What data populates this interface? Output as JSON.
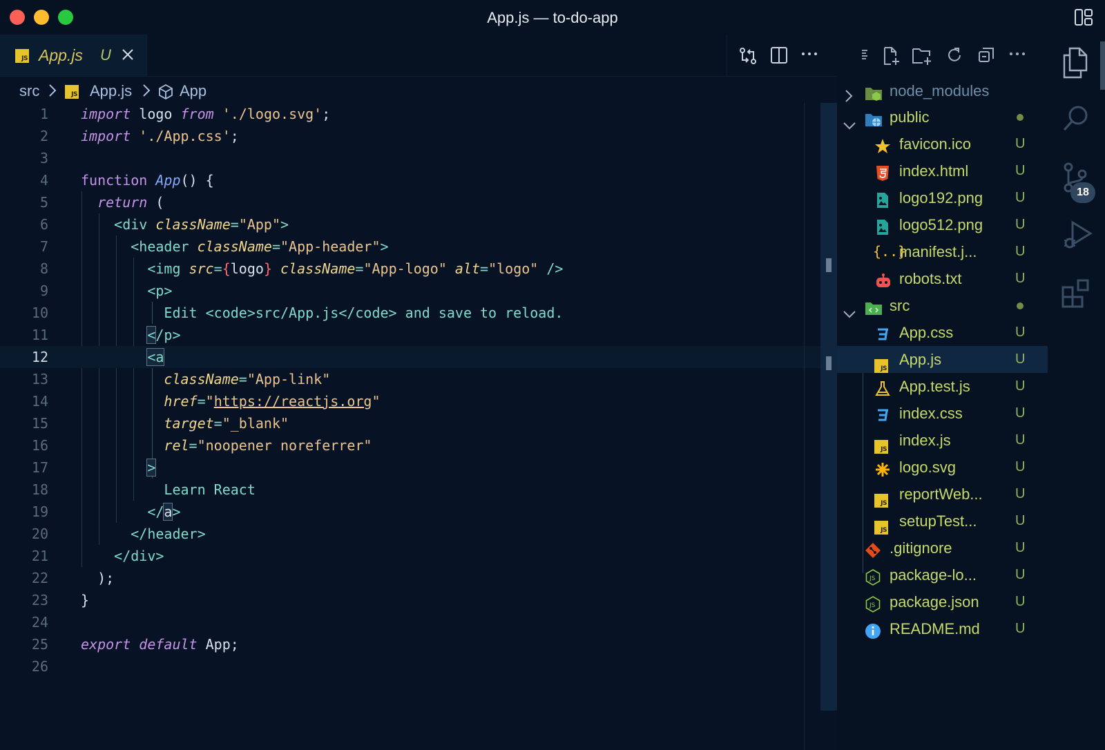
{
  "window": {
    "title": "App.js — to-do-app"
  },
  "tab": {
    "label": "App.js",
    "status": "U",
    "icon": "js-file-icon"
  },
  "breadcrumb": {
    "folder": "src",
    "file": "App.js",
    "symbol": "App"
  },
  "editor": {
    "current_line": 12,
    "lines": [
      {
        "n": "1"
      },
      {
        "n": "2"
      },
      {
        "n": "3"
      },
      {
        "n": "4"
      },
      {
        "n": "5"
      },
      {
        "n": "6"
      },
      {
        "n": "7"
      },
      {
        "n": "8"
      },
      {
        "n": "9"
      },
      {
        "n": "10"
      },
      {
        "n": "11"
      },
      {
        "n": "12"
      },
      {
        "n": "13"
      },
      {
        "n": "14"
      },
      {
        "n": "15"
      },
      {
        "n": "16"
      },
      {
        "n": "17"
      },
      {
        "n": "18"
      },
      {
        "n": "19"
      },
      {
        "n": "20"
      },
      {
        "n": "21"
      },
      {
        "n": "22"
      },
      {
        "n": "23"
      },
      {
        "n": "24"
      },
      {
        "n": "25"
      },
      {
        "n": "26"
      }
    ],
    "code": {
      "l1": [
        "import",
        "logo",
        "from",
        "'./logo.svg'",
        ";"
      ],
      "l2": [
        "import",
        "'./App.css'",
        ";"
      ],
      "l4": [
        "function",
        "App",
        "() {"
      ],
      "l5": [
        "return",
        "("
      ],
      "l6": [
        "<div",
        "className",
        "=",
        "\"App\"",
        ">"
      ],
      "l7": [
        "<header",
        "className",
        "=",
        "\"App-header\"",
        ">"
      ],
      "l8": [
        "<img",
        "src",
        "=",
        "{",
        "logo",
        "}",
        "className",
        "=",
        "\"App-logo\"",
        "alt",
        "=",
        "\"logo\"",
        "/>"
      ],
      "l9": [
        "<p>"
      ],
      "l10": [
        "Edit ",
        "<code>",
        "src/App.js",
        "</code>",
        " and save to reload."
      ],
      "l11": [
        "<",
        "/p>"
      ],
      "l12": [
        "<a"
      ],
      "l13": [
        "className",
        "=",
        "\"App-link\""
      ],
      "l14": [
        "href",
        "=",
        "\"",
        "https://reactjs.org",
        "\""
      ],
      "l15": [
        "target",
        "=",
        "\"_blank\""
      ],
      "l16": [
        "rel",
        "=",
        "\"noopener noreferrer\""
      ],
      "l17": [
        ">"
      ],
      "l18": [
        "Learn React"
      ],
      "l19": [
        "</",
        "a",
        ">"
      ],
      "l20": [
        "</header>"
      ],
      "l21": [
        "</div>"
      ],
      "l22": [
        ");"
      ],
      "l23": [
        "}"
      ],
      "l25": [
        "export",
        "default",
        "App;"
      ]
    }
  },
  "explorer": {
    "items": [
      {
        "name": "node_modules",
        "type": "folder",
        "expanded": false,
        "status": "",
        "icon": "node-folder-icon",
        "color": "#6f8fa8"
      },
      {
        "name": "public",
        "type": "folder",
        "expanded": true,
        "status": "dot",
        "icon": "public-folder-icon",
        "color": "#c6d96a"
      },
      {
        "name": "favicon.ico",
        "type": "file",
        "status": "U",
        "icon": "star-icon",
        "color": "#c6d96a"
      },
      {
        "name": "index.html",
        "type": "file",
        "status": "U",
        "icon": "html5-icon",
        "color": "#c6d96a"
      },
      {
        "name": "logo192.png",
        "type": "file",
        "status": "U",
        "icon": "image-icon",
        "color": "#c6d96a"
      },
      {
        "name": "logo512.png",
        "type": "file",
        "status": "U",
        "icon": "image-icon",
        "color": "#c6d96a"
      },
      {
        "name": "manifest.j...",
        "type": "file",
        "status": "U",
        "icon": "json-icon",
        "color": "#c6d96a"
      },
      {
        "name": "robots.txt",
        "type": "file",
        "status": "U",
        "icon": "robot-icon",
        "color": "#c6d96a"
      },
      {
        "name": "src",
        "type": "folder",
        "expanded": true,
        "status": "dot",
        "icon": "src-folder-icon",
        "color": "#c6d96a"
      },
      {
        "name": "App.css",
        "type": "file",
        "status": "U",
        "icon": "css-icon",
        "color": "#c6d96a"
      },
      {
        "name": "App.js",
        "type": "file",
        "status": "U",
        "icon": "js-file-icon",
        "color": "#c6d96a",
        "selected": true
      },
      {
        "name": "App.test.js",
        "type": "file",
        "status": "U",
        "icon": "flask-icon",
        "color": "#c6d96a"
      },
      {
        "name": "index.css",
        "type": "file",
        "status": "U",
        "icon": "css-icon",
        "color": "#c6d96a"
      },
      {
        "name": "index.js",
        "type": "file",
        "status": "U",
        "icon": "js-file-icon",
        "color": "#c6d96a"
      },
      {
        "name": "logo.svg",
        "type": "file",
        "status": "U",
        "icon": "svg-icon",
        "color": "#c6d96a"
      },
      {
        "name": "reportWeb...",
        "type": "file",
        "status": "U",
        "icon": "js-file-icon",
        "color": "#c6d96a"
      },
      {
        "name": "setupTest...",
        "type": "file",
        "status": "U",
        "icon": "js-file-icon",
        "color": "#c6d96a"
      },
      {
        "name": ".gitignore",
        "type": "file",
        "status": "U",
        "icon": "git-icon",
        "color": "#c6d96a"
      },
      {
        "name": "package-lo...",
        "type": "file",
        "status": "U",
        "icon": "nodejs-icon",
        "color": "#c6d96a"
      },
      {
        "name": "package.json",
        "type": "file",
        "status": "U",
        "icon": "nodejs-icon",
        "color": "#c6d96a"
      },
      {
        "name": "README.md",
        "type": "file",
        "status": "U",
        "icon": "info-icon",
        "color": "#c6d96a"
      }
    ]
  },
  "activity": {
    "scm_badge": "18"
  },
  "colors": {
    "background": "#071324",
    "accent_yellow": "#dcc75a",
    "git_untracked": "#8fb45e"
  }
}
